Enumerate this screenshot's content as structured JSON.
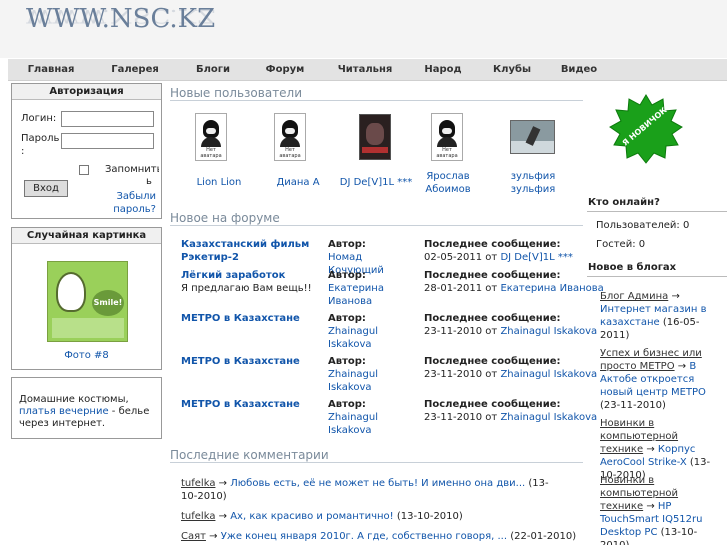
{
  "site": {
    "logo": "WWW.NSC.KZ"
  },
  "nav": [
    "Главная",
    "Галерея",
    "Блоги",
    "Форум",
    "Читальня",
    "Народ",
    "Клубы",
    "Видео"
  ],
  "auth": {
    "title": "Авторизация",
    "login_label": "Логин:",
    "password_label": "Пароль\n:",
    "remember_label": "Запомнить",
    "submit": "Вход",
    "forgot": "Забыли пароль?"
  },
  "random_pic": {
    "title": "Случайная картинка",
    "caption": "Фото #8",
    "image_text": "Smile!"
  },
  "ad": {
    "text_before": "Домашние костюмы, ",
    "link": "платья вечерние",
    "text_after": " - белье через интернет."
  },
  "new_users": {
    "title": "Новые пользователи",
    "no_avatar": "Нет аватара",
    "items": [
      {
        "name": "Lion Lion"
      },
      {
        "name": "Диана А"
      },
      {
        "name": "DJ De[V]1L ***"
      },
      {
        "name": "Ярослав Абоимов"
      },
      {
        "name": "зульфия зульфия"
      }
    ]
  },
  "forum": {
    "title": "Новое на форуме",
    "author_label": "Автор:",
    "last_label": "Последнее сообщение:",
    "rows": [
      {
        "topic": "Казахстанский фильм Рэкетир-2",
        "desc": "",
        "author": "Номад Кочующий",
        "date": "02-05-2011 от",
        "last_author": "DJ De[V]1L ***"
      },
      {
        "topic": "Лёгкий заработок",
        "desc": "Я предлагаю Вам вещь!!",
        "author": "Екатерина Иванова",
        "date": "28-01-2011 от",
        "last_author": "Екатерина Иванова"
      },
      {
        "topic": "МЕТРО в Казахстане",
        "desc": "",
        "author": "Zhainagul Iskakova",
        "date": "23-11-2010 от",
        "last_author": "Zhainagul Iskakova"
      },
      {
        "topic": "МЕТРО в Казахстане",
        "desc": "",
        "author": "Zhainagul Iskakova",
        "date": "23-11-2010 от",
        "last_author": "Zhainagul Iskakova"
      },
      {
        "topic": "МЕТРО в Казахстане",
        "desc": "",
        "author": "Zhainagul Iskakova",
        "date": "23-11-2010 от",
        "last_author": "Zhainagul Iskakova"
      }
    ]
  },
  "comments": {
    "title": "Последние комментарии",
    "items": [
      {
        "user": "tufelka",
        "text": "Любовь есть, её не может не быть! И именно она дви...",
        "date": "(13-10-2010)"
      },
      {
        "user": "tufelka",
        "text": "Ах, как красиво и романтично!",
        "date": "(13-10-2010)"
      },
      {
        "user": "Саят",
        "text": "Уже конец января 2010г. А где, собственно говоря, ...",
        "date": "(22-01-2010)"
      }
    ]
  },
  "badge": {
    "text": "Я НОВИЧОК!"
  },
  "online": {
    "title": "Кто онлайн?",
    "users_label": "Пользователей:",
    "users_count": "0",
    "guests_label": "Гостей:",
    "guests_count": "0"
  },
  "blogs": {
    "title": "Новое в блогах",
    "items": [
      {
        "blog": "Блог Админа",
        "post": "Интернет магазин в казахстане",
        "date": "(16-05-2011)"
      },
      {
        "blog": "Успех и бизнес или просто МЕТРО",
        "post": "В Актобе откроется новый центр МЕТРО",
        "date": "(23-11-2010)"
      },
      {
        "blog": "Новинки в компьютерной технике",
        "post": "Корпус AeroCool Strike-X",
        "date": "(13-10-2010)"
      },
      {
        "blog": "Новинки в компьютерной технике",
        "post": "HP TouchSmart IQ512ru Desktop PC",
        "date": "(13-10-2010)"
      }
    ]
  },
  "colors": {
    "nav_bg": "#e3e3e3",
    "link": "#1155aa",
    "badge": "#1aa01a",
    "section_title": "#7a8a9a"
  }
}
